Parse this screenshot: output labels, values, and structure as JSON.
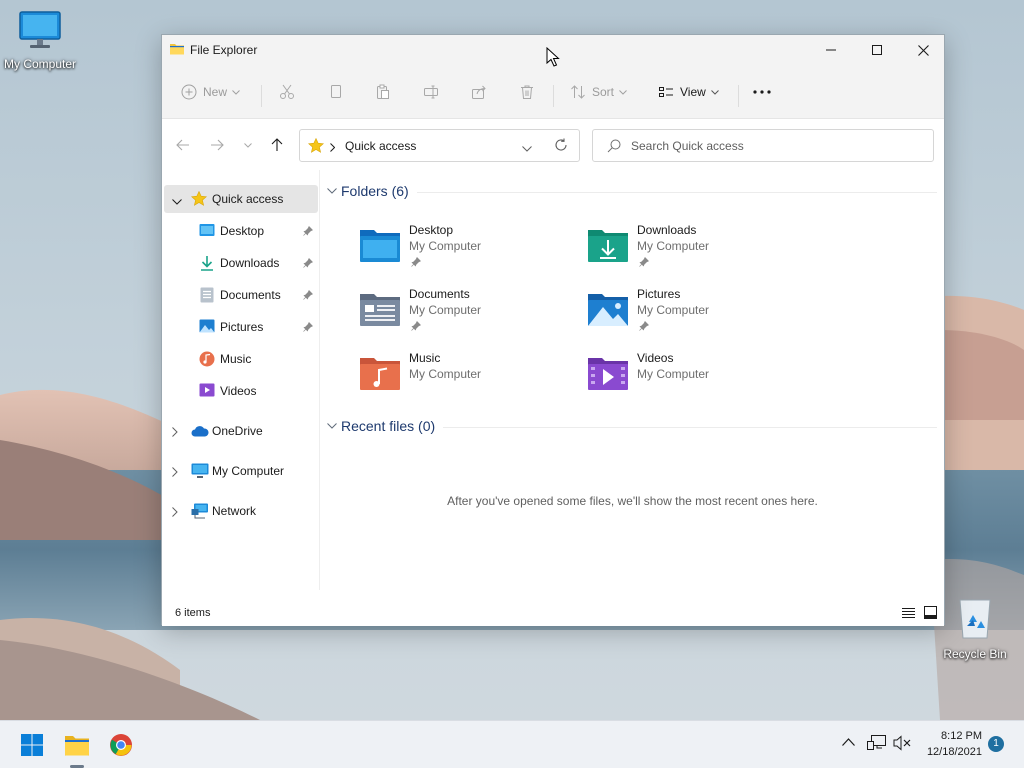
{
  "desktop": {
    "icons": [
      {
        "label": "My Computer",
        "icon": "monitor-icon"
      },
      {
        "label": "Recycle Bin",
        "icon": "recycle-bin-icon"
      }
    ]
  },
  "window": {
    "title": "File Explorer",
    "app_icon": "folder-icon",
    "controls": {
      "minimize": "minimize-icon",
      "maximize": "maximize-icon",
      "close": "close-icon"
    }
  },
  "commandbar": {
    "new_label": "New",
    "sort_label": "Sort",
    "view_label": "View",
    "icons": [
      "cut-icon",
      "copy-icon",
      "paste-icon",
      "rename-icon",
      "share-icon",
      "delete-icon",
      "more-icon"
    ]
  },
  "address": {
    "crumb": "Quick access",
    "icon": "star-icon"
  },
  "search": {
    "placeholder": "Search Quick access",
    "value": ""
  },
  "navpane": {
    "quick_access": "Quick access",
    "pinned": [
      {
        "label": "Desktop",
        "icon": "desktop-folder-icon",
        "pinned": true
      },
      {
        "label": "Downloads",
        "icon": "download-icon",
        "pinned": true
      },
      {
        "label": "Documents",
        "icon": "document-icon",
        "pinned": true
      },
      {
        "label": "Pictures",
        "icon": "picture-icon",
        "pinned": true
      },
      {
        "label": "Music",
        "icon": "music-icon",
        "pinned": false
      },
      {
        "label": "Videos",
        "icon": "video-icon",
        "pinned": false
      }
    ],
    "onedrive": "OneDrive",
    "my_computer": "My Computer",
    "network": "Network"
  },
  "content": {
    "folders_header": "Folders (6)",
    "folders": [
      {
        "name": "Desktop",
        "location": "My Computer",
        "pinned": true,
        "color": "#1a8ad4"
      },
      {
        "name": "Downloads",
        "location": "My Computer",
        "pinned": true,
        "color": "#1aa38a"
      },
      {
        "name": "Documents",
        "location": "My Computer",
        "pinned": true,
        "color": "#7a8aa0"
      },
      {
        "name": "Pictures",
        "location": "My Computer",
        "pinned": true,
        "color": "#1e7fd0"
      },
      {
        "name": "Music",
        "location": "My Computer",
        "pinned": false,
        "color": "#e8704c"
      },
      {
        "name": "Videos",
        "location": "My Computer",
        "pinned": false,
        "color": "#8a4ad0"
      }
    ],
    "recent_header": "Recent files (0)",
    "empty_message": "After you've opened some files, we'll show the most recent ones here."
  },
  "status": {
    "item_count": "6 items"
  },
  "taskbar": {
    "time": "8:12 PM",
    "date": "12/18/2021",
    "notifications": "1",
    "accent": "#0078d4"
  }
}
